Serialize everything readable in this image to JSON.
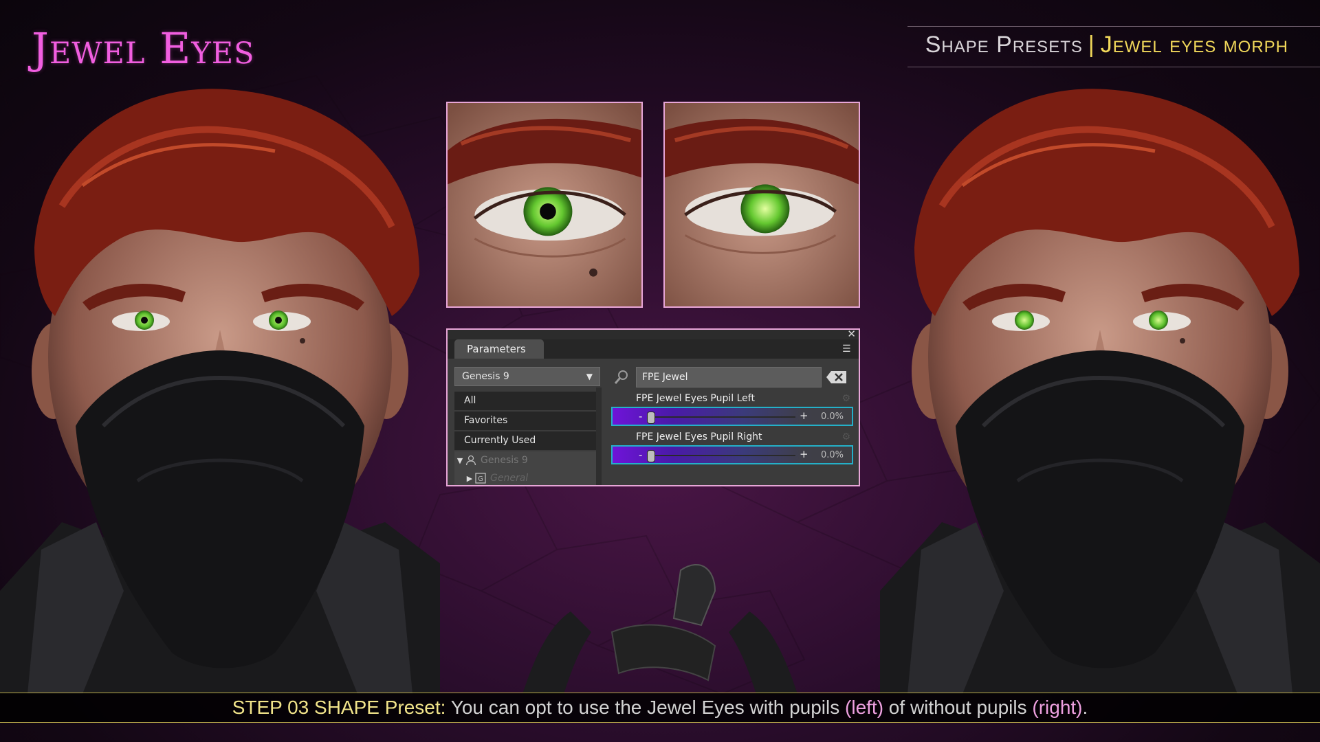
{
  "header": {
    "brand": "Jewel Eyes",
    "section": "Shape Presets",
    "separator": "|",
    "subtitle": "Jewel eyes morph"
  },
  "colors": {
    "brand": "#f15ee0",
    "accent_gold": "#f1d85a",
    "panel_border": "#e8a6d8",
    "slider_border": "#24b0c8",
    "slider_fill": "#6f14d8",
    "iris_green": "#6fd23a"
  },
  "panel": {
    "tab_label": "Parameters",
    "figure_select": "Genesis 9",
    "groups": [
      "All",
      "Favorites",
      "Currently Used"
    ],
    "tree": [
      {
        "label": "Genesis 9",
        "icon": "figure-icon"
      },
      {
        "label": "General",
        "icon": "group-icon"
      }
    ],
    "search": {
      "value": "FPE Jewel"
    },
    "params": [
      {
        "label": "FPE Jewel Eyes Pupil Left",
        "value": "0.0%",
        "fraction": 0.0
      },
      {
        "label": "FPE Jewel Eyes Pupil Right",
        "value": "0.0%",
        "fraction": 0.0
      }
    ]
  },
  "caption": {
    "step": "STEP 03 SHAPE Preset:",
    "text1": " You can opt to use the Jewel Eyes with pupils ",
    "left": "(left)",
    "text2": " of without pupils ",
    "right": "(right)",
    "end": "."
  }
}
